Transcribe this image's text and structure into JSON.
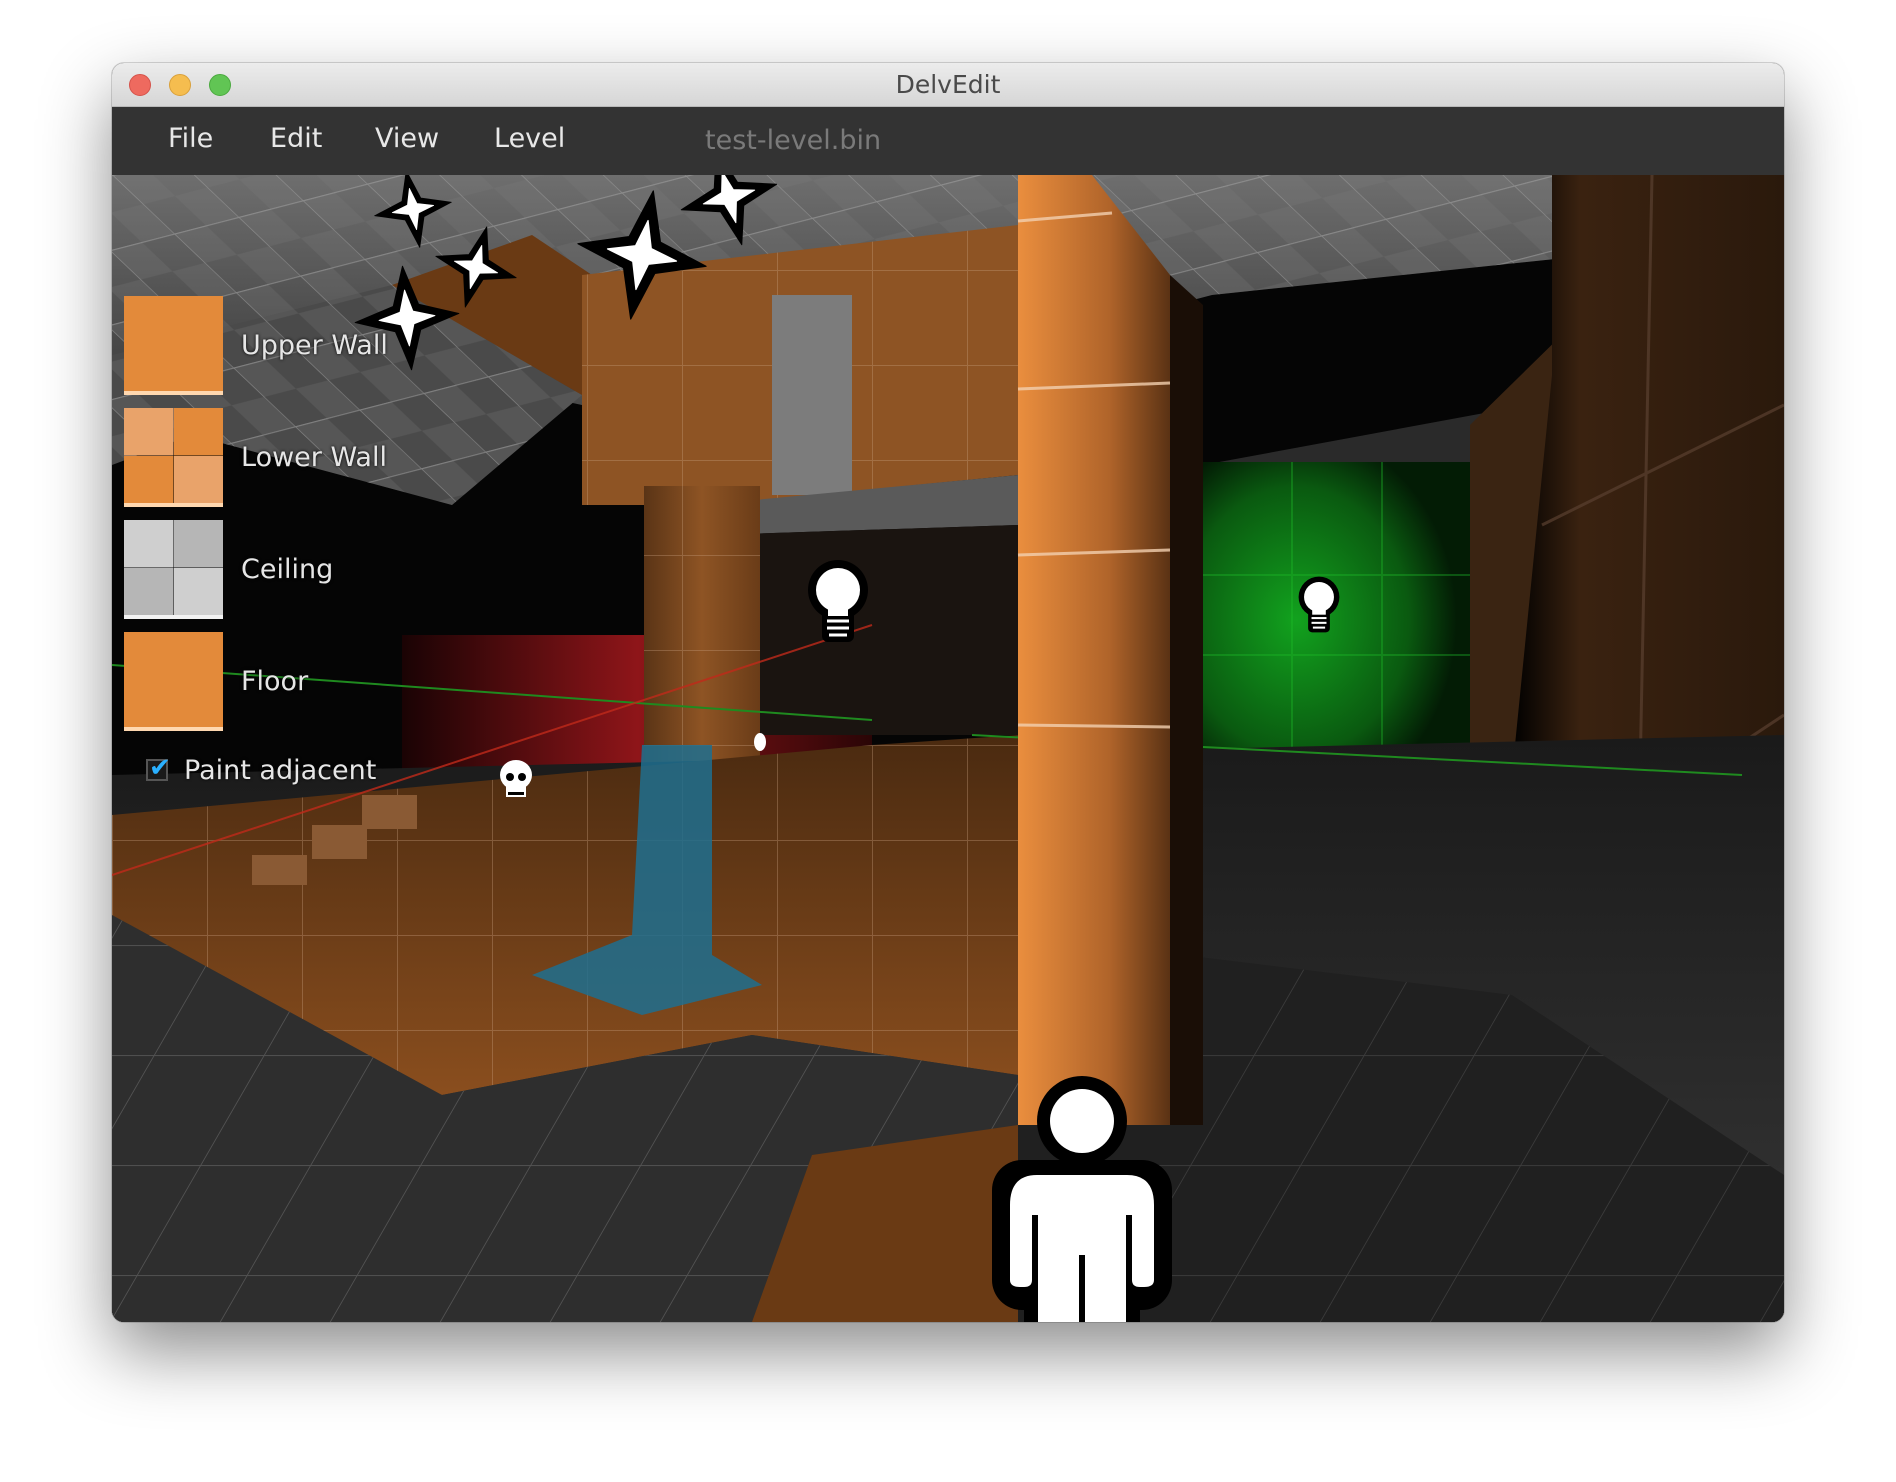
{
  "window": {
    "title": "DelvEdit",
    "controls": [
      "close",
      "minimize",
      "maximize"
    ]
  },
  "menubar": {
    "items": [
      {
        "label": "File"
      },
      {
        "label": "Edit"
      },
      {
        "label": "View"
      },
      {
        "label": "Level"
      }
    ],
    "filename": "test-level.bin"
  },
  "palette": {
    "swatches": [
      {
        "label": "Upper Wall",
        "texture": "orange-solid"
      },
      {
        "label": "Lower Wall",
        "texture": "orange-checker"
      },
      {
        "label": "Ceiling",
        "texture": "grey-checker"
      },
      {
        "label": "Floor",
        "texture": "orange-solid"
      }
    ],
    "paint_adjacent": {
      "label": "Paint adjacent",
      "checked": true
    }
  },
  "scene": {
    "markers": [
      {
        "type": "star-icon",
        "name": "particle-emitter"
      },
      {
        "type": "star-icon",
        "name": "particle-emitter"
      },
      {
        "type": "star-icon",
        "name": "particle-emitter"
      },
      {
        "type": "star-icon",
        "name": "particle-emitter"
      },
      {
        "type": "star-icon",
        "name": "particle-emitter"
      },
      {
        "type": "light-bulb-icon",
        "name": "light-entity"
      },
      {
        "type": "light-bulb-icon",
        "name": "light-entity"
      },
      {
        "type": "skull-icon",
        "name": "monster-entity"
      },
      {
        "type": "player-icon",
        "name": "player-start"
      }
    ],
    "colors": {
      "wall_orange": "#e38a3a",
      "light_green": "#0f8a1a",
      "light_red": "#9a1518",
      "water_blue": "#1f6f8f",
      "ceiling_grey": "#8a8a8a",
      "floor_grey": "#2e2e2e"
    }
  }
}
